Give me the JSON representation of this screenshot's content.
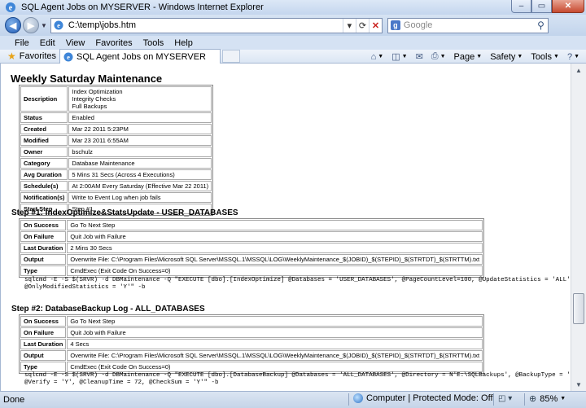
{
  "window": {
    "title": "SQL Agent Jobs on MYSERVER - Windows Internet Explorer",
    "min_glyph": "–",
    "max_glyph": "▭",
    "close_glyph": "✕"
  },
  "address_bar": {
    "url": "C:\\temp\\jobs.htm",
    "search_placeholder": "Google"
  },
  "menu": [
    "File",
    "Edit",
    "View",
    "Favorites",
    "Tools",
    "Help"
  ],
  "favorites_bar": {
    "favorites_label": "Favorites",
    "tab_title": "SQL Agent Jobs on MYSERVER"
  },
  "command_bar": {
    "page": "Page",
    "safety": "Safety",
    "tools": "Tools"
  },
  "job": {
    "name": "Weekly Saturday Maintenance",
    "description_lines": [
      "Index Optimization",
      "Integrity Checks",
      "Full Backups"
    ],
    "rows": [
      {
        "label": "Description",
        "value": ""
      },
      {
        "label": "Status",
        "value": "Enabled"
      },
      {
        "label": "Created",
        "value": "Mar 22 2011 5:23PM"
      },
      {
        "label": "Modified",
        "value": "Mar 23 2011 6:55AM"
      },
      {
        "label": "Owner",
        "value": "bschulz"
      },
      {
        "label": "Category",
        "value": "Database Maintenance"
      },
      {
        "label": "Avg Duration",
        "value": "5 Mins 31 Secs (Across 4 Executions)"
      },
      {
        "label": "Schedule(s)",
        "value": "At 2:00AM Every Saturday (Effective Mar 22 2011)"
      },
      {
        "label": "Notification(s)",
        "value": "Write to Event Log when job fails"
      },
      {
        "label": "Start Step",
        "value": "Step #1"
      }
    ]
  },
  "steps": [
    {
      "heading": "Step #1: IndexOptimize&StatsUpdate - USER_DATABASES",
      "rows": [
        {
          "label": "On Success",
          "value": "Go To Next Step"
        },
        {
          "label": "On Failure",
          "value": "Quit Job with Failure"
        },
        {
          "label": "Last Duration",
          "value": "2 Mins 30 Secs"
        },
        {
          "label": "Output",
          "value": "Overwrite File: C:\\Program Files\\Microsoft SQL Server\\MSSQL.1\\MSSQL\\LOG\\WeeklyMaintenance_$(JOBID)_$(STEPID)_$(STRTDT)_$(STRTTM).txt"
        },
        {
          "label": "Type",
          "value": "CmdExec (Exit Code On Success=0)"
        }
      ],
      "command_line1": "sqlcmd -E -S $(SRVR) -d DBMaintenance -Q \"EXECUTE [dbo].[IndexOptimize] @Databases = 'USER_DATABASES', @PageCountLevel=100, @UpdateStatistics = 'ALL',",
      "command_line2": "@OnlyModifiedStatistics = 'Y'\" -b"
    },
    {
      "heading": "Step #2: DatabaseBackup Log - ALL_DATABASES",
      "rows": [
        {
          "label": "On Success",
          "value": "Go To Next Step"
        },
        {
          "label": "On Failure",
          "value": "Quit Job with Failure"
        },
        {
          "label": "Last Duration",
          "value": "4 Secs"
        },
        {
          "label": "Output",
          "value": "Overwrite File: C:\\Program Files\\Microsoft SQL Server\\MSSQL.1\\MSSQL\\LOG\\WeeklyMaintenance_$(JOBID)_$(STEPID)_$(STRTDT)_$(STRTTM).txt"
        },
        {
          "label": "Type",
          "value": "CmdExec (Exit Code On Success=0)"
        }
      ],
      "command_line1": "sqlcmd -E -S $(SRVR) -d DBMaintenance -Q \"EXECUTE [dbo].[DatabaseBackup] @Databases = 'ALL_DATABASES', @Directory = N'E:\\SQLBackups', @BackupType = 'LOG',",
      "command_line2": "@Verify = 'Y', @CleanupTime = 72, @CheckSum = 'Y'\" -b"
    }
  ],
  "status_bar": {
    "text": "Done",
    "zone": "Computer | Protected Mode: Off",
    "zoom": "85%"
  }
}
